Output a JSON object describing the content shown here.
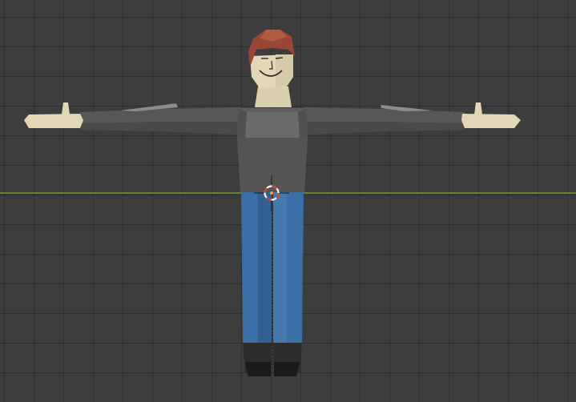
{
  "viewport": {
    "background_color": "#3d3d3d",
    "grid_line_color": "#2f2f2f",
    "x_axis_color": "#6f9a2a"
  },
  "character": {
    "skin_color": "#e2d7b6",
    "hair_color": "#9a4535",
    "shirt_color": "#555555",
    "pants_color": "#3b6ea6",
    "shoes_color": "#2c2c2c"
  },
  "cursor_3d": {
    "icon": "3d-cursor-icon",
    "ring_color_a": "#d33b2c",
    "ring_color_b": "#ffffff"
  }
}
